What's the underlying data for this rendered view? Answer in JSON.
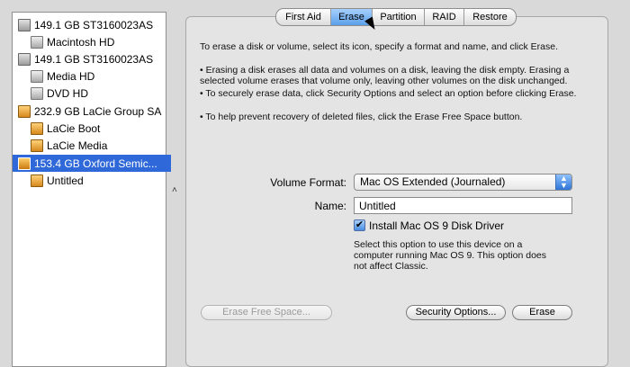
{
  "sidebar": {
    "items": [
      {
        "label": "149.1 GB ST3160023AS",
        "icon": "hard-disk-icon",
        "type": "disk"
      },
      {
        "label": "Macintosh HD",
        "icon": "volume-icon",
        "type": "volume"
      },
      {
        "label": "149.1 GB ST3160023AS",
        "icon": "hard-disk-icon",
        "type": "disk"
      },
      {
        "label": "Media HD",
        "icon": "volume-icon",
        "type": "volume"
      },
      {
        "label": "DVD HD",
        "icon": "volume-icon",
        "type": "volume"
      },
      {
        "label": "232.9 GB LaCie Group SA",
        "icon": "lacie-disk-icon",
        "type": "disk"
      },
      {
        "label": "LaCie Boot",
        "icon": "lacie-volume-icon",
        "type": "volume"
      },
      {
        "label": "LaCie Media",
        "icon": "lacie-volume-icon",
        "type": "volume"
      },
      {
        "label": "153.4 GB Oxford Semic...",
        "icon": "external-disk-icon",
        "type": "disk",
        "selected": true
      },
      {
        "label": "Untitled",
        "icon": "external-volume-icon",
        "type": "volume"
      }
    ]
  },
  "tabs": [
    {
      "label": "First Aid",
      "active": false
    },
    {
      "label": "Erase",
      "active": true
    },
    {
      "label": "Partition",
      "active": false
    },
    {
      "label": "RAID",
      "active": false
    },
    {
      "label": "Restore",
      "active": false
    }
  ],
  "erase": {
    "intro": "To erase a disk or volume, select its icon, specify a format and name, and click Erase.",
    "bullets": [
      "• Erasing a disk erases all data and volumes on a disk, leaving the disk empty. Erasing a selected volume erases that volume only, leaving other volumes on the disk unchanged.",
      "• To securely erase data, click Security Options and select an option before clicking Erase.",
      "• To help prevent recovery of deleted files, click the Erase Free Space button."
    ],
    "volume_format_label": "Volume Format:",
    "volume_format_value": "Mac OS Extended (Journaled)",
    "name_label": "Name:",
    "name_value": "Untitled",
    "os9_checkbox_label": "Install Mac OS 9 Disk Driver",
    "os9_checked": true,
    "os9_help": "Select this option to use this device on a computer running Mac OS 9. This option does not affect Classic.",
    "erase_free_space_label": "Erase Free Space...",
    "security_options_label": "Security Options...",
    "erase_button_label": "Erase"
  },
  "colors": {
    "selection": "#2f68d8",
    "active_tab": "#5a9fe8",
    "panel_background": "#e4e4e4"
  }
}
